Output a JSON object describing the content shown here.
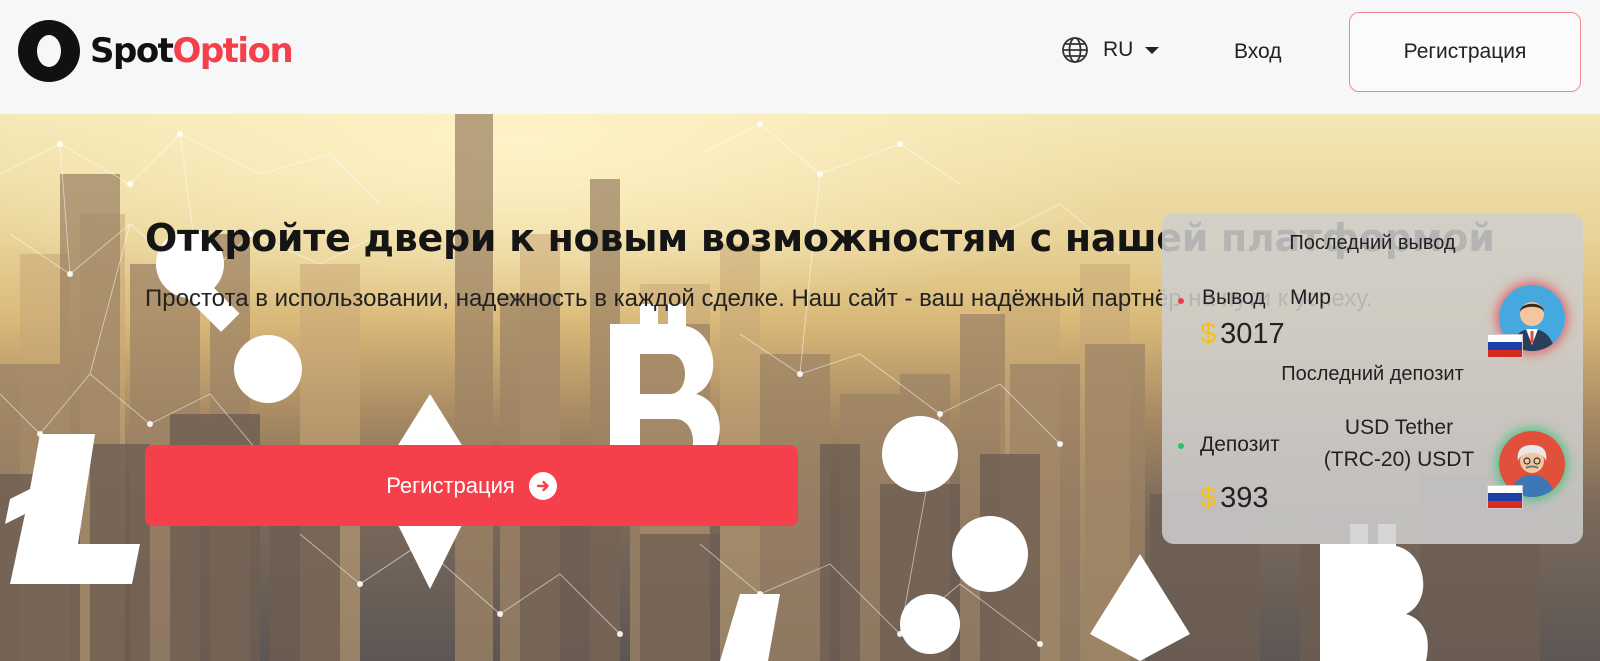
{
  "header": {
    "logo": {
      "part1": "Spot",
      "part2": "Option"
    },
    "language": {
      "code": "RU",
      "icon": "globe-icon"
    },
    "login_label": "Вход",
    "register_label": "Регистрация"
  },
  "hero": {
    "title": "Откройте двери к новым возможностям с нашей платформой",
    "subtitle": "Простота в использовании, надежность в каждой сделке. Наш сайт - ваш надёжный партнёр на пути к успеху.",
    "cta_label": "Регистрация",
    "cta_icon": "arrow-right-circle-icon"
  },
  "feed": {
    "withdrawal": {
      "heading": "Последний вывод",
      "type_label": "Вывод",
      "method": "Мир",
      "currency_symbol": "$",
      "amount": "3017",
      "status_color": "#e8404a",
      "country_flag": "ru"
    },
    "deposit": {
      "heading": "Последний депозит",
      "type_label": "Депозит",
      "method_line1": "USD Tether",
      "method_line2": "(TRC-20) USDT",
      "currency_symbol": "$",
      "amount": "393",
      "status_color": "#27c26a",
      "country_flag": "ru"
    }
  },
  "colors": {
    "accent": "#f5404c",
    "currency": "#f2c21b"
  }
}
